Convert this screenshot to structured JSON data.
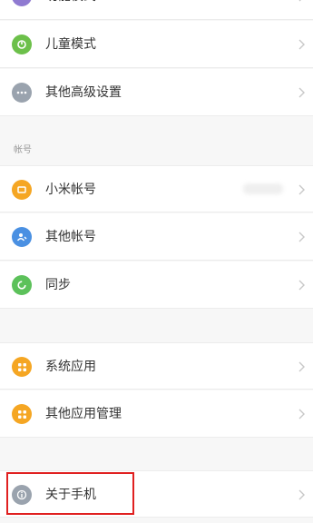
{
  "settings": {
    "items": [
      {
        "label": "功能模式",
        "icon": "mode-icon",
        "color": "#8f7ad1"
      },
      {
        "label": "儿童模式",
        "icon": "child-mode-icon",
        "color": "#6cc04a"
      },
      {
        "label": "其他高级设置",
        "icon": "more-icon",
        "color": "#9aa3ae"
      }
    ],
    "account_section_title": "帐号",
    "account_items": [
      {
        "label": "小米帐号",
        "icon": "mi-account-icon",
        "color": "#f5a623"
      },
      {
        "label": "其他帐号",
        "icon": "other-account-icon",
        "color": "#4a90e2"
      },
      {
        "label": "同步",
        "icon": "sync-icon",
        "color": "#5cc15a"
      }
    ],
    "app_items": [
      {
        "label": "系统应用",
        "icon": "system-apps-icon",
        "color": "#f5a623"
      },
      {
        "label": "其他应用管理",
        "icon": "app-management-icon",
        "color": "#f5a623"
      }
    ],
    "about": {
      "label": "关于手机",
      "icon": "info-icon",
      "color": "#9aa3ae"
    },
    "highlight_color": "#e02020"
  }
}
